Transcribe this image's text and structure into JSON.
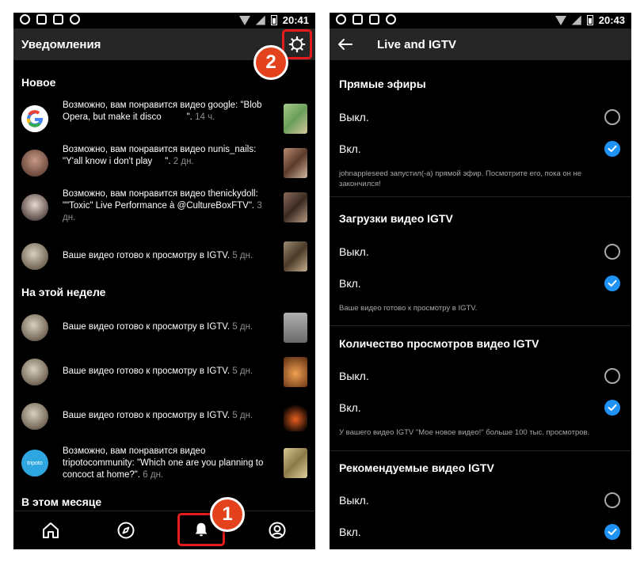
{
  "left": {
    "status_time": "20:41",
    "title": "Уведомления",
    "sections": [
      {
        "title": "Новое",
        "items": [
          {
            "text": "Возможно, вам понравится видео google: \"Blob Opera, but make it disco          \".",
            "time": "14 ч.",
            "avatar": "google-logo",
            "thumb_color": "#7ea86a"
          },
          {
            "text": "Возможно, вам понравится видео nunis_nails: \"Y'all know i don't play     \".",
            "time": "2 дн.",
            "avatar": "person",
            "thumb_color": "#8a5a4a"
          },
          {
            "text": "Возможно, вам понравится видео thenickydoll: \"\"Toxic\" Live Performance à @CultureBoxFTV\".",
            "time": "3 дн.",
            "avatar": "person",
            "thumb_color": "#6b4a3a"
          },
          {
            "text": "Ваше видео готово к просмотру в IGTV.",
            "time": "5 дн.",
            "avatar": "person",
            "thumb_color": "#7a6a55"
          }
        ]
      },
      {
        "title": "На этой неделе",
        "items": [
          {
            "text": "Ваше видео готово к просмотру в IGTV.",
            "time": "5 дн.",
            "avatar": "person",
            "thumb_color": "#8c8c8c"
          },
          {
            "text": "Ваше видео готово к просмотру в IGTV.",
            "time": "5 дн.",
            "avatar": "person",
            "thumb_color": "#a0522d"
          },
          {
            "text": "Ваше видео готово к просмотру в IGTV.",
            "time": "5 дн.",
            "avatar": "person",
            "thumb_color": "#1a0a05"
          },
          {
            "text": "Возможно, вам понравится видео tripotocommunity: \"Which one are you planning to concoct at home?\".",
            "time": "6 дн.",
            "avatar": "tripoto-logo",
            "thumb_color": "#c8b87a"
          }
        ]
      },
      {
        "title": "В этом месяце",
        "items": []
      }
    ],
    "tabs": [
      "home-icon",
      "explore-icon",
      "bell-icon",
      "profile-icon"
    ],
    "badge_1": "1",
    "badge_2": "2",
    "avatar_logo_text": "tripoto"
  },
  "right": {
    "status_time": "20:43",
    "title": "Live and IGTV",
    "groups": [
      {
        "title": "Прямые эфиры",
        "off_label": "Выкл.",
        "on_label": "Вкл.",
        "selected": "on",
        "desc": "johnappleseed запустил(-а) прямой эфир. Посмотрите его, пока он не закончился!"
      },
      {
        "title": "Загрузки видео IGTV",
        "off_label": "Выкл.",
        "on_label": "Вкл.",
        "selected": "on",
        "desc": "Ваше видео готово к просмотру в IGTV."
      },
      {
        "title": "Количество просмотров видео IGTV",
        "off_label": "Выкл.",
        "on_label": "Вкл.",
        "selected": "on",
        "desc": "У вашего видео IGTV \"Мое новое видео!\" больше 100 тыс. просмотров."
      },
      {
        "title": "Рекомендуемые видео IGTV",
        "off_label": "Выкл.",
        "on_label": "Вкл.",
        "selected": "on",
        "desc": ""
      }
    ]
  },
  "colors": {
    "accent_blue": "#1e92f5",
    "highlight_red": "#e51c1c",
    "badge_orange": "#e3421c",
    "appbar": "#262626"
  }
}
